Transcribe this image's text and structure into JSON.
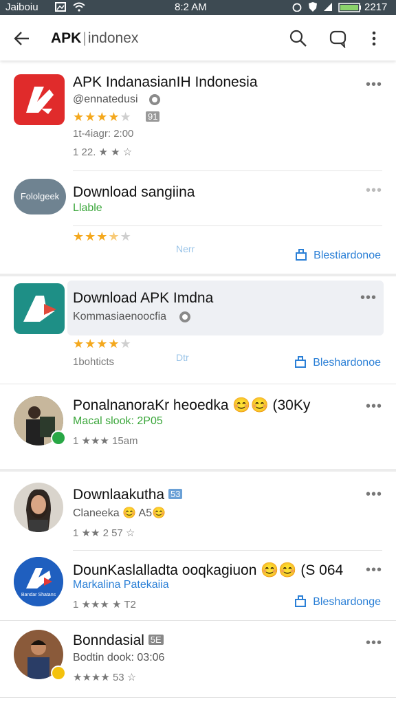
{
  "status_bar": {
    "left": "Jaiboiu",
    "time": "8:2 AM",
    "battery": "2217"
  },
  "app_bar": {
    "title_main": "APK",
    "title_rest": "indonex"
  },
  "items": [
    {
      "name": "APK IndanasianIH Indonesia",
      "sub": "@ennatedusi",
      "rating_count": "91",
      "meta": "1t-4iagr: 2:00",
      "meta2": "1 22. ★ ★ ☆",
      "stars": 4
    },
    {
      "name": "Download sangiina",
      "icon_text": "Fololgeek",
      "sub": "Llable",
      "link_faded": "Nerr",
      "install": "Blestiardonoe",
      "stars": 3.5
    },
    {
      "name": "Download APK Imdna",
      "sub": "Kommasiaenoocfia",
      "meta": "1bohticts",
      "link_faded": "Dtr",
      "install": "Bleshardonoe",
      "stars": 4
    },
    {
      "name": "PonalnanoraKr heoedka 😊😊 (30Ky",
      "sub": "Macal slook: 2P05",
      "meta": "1 ★★★ 15am"
    },
    {
      "name": "Downlaakutha",
      "tag": "53",
      "sub": "Claneeka 😊 A5😊",
      "meta": "1 ★★ 2 57 ☆"
    },
    {
      "name": "DounKaslalladta ooqkagiuon 😊😊 (S 064",
      "icon_text": "Bandar Shatans",
      "sub": "Markalina Patekaiia",
      "meta": "1 ★★★ ★ T2",
      "install": "Bleshardonge"
    },
    {
      "name": "Bonndasial",
      "tag": "5E",
      "sub": "Bodtin dook: 03:06",
      "meta": "★★★★ 53 ☆"
    }
  ],
  "colors": {
    "accent": "#2a7fd6",
    "star": "#f4a81d",
    "green": "#3aa63a",
    "statusbar": "#3d4a52"
  }
}
